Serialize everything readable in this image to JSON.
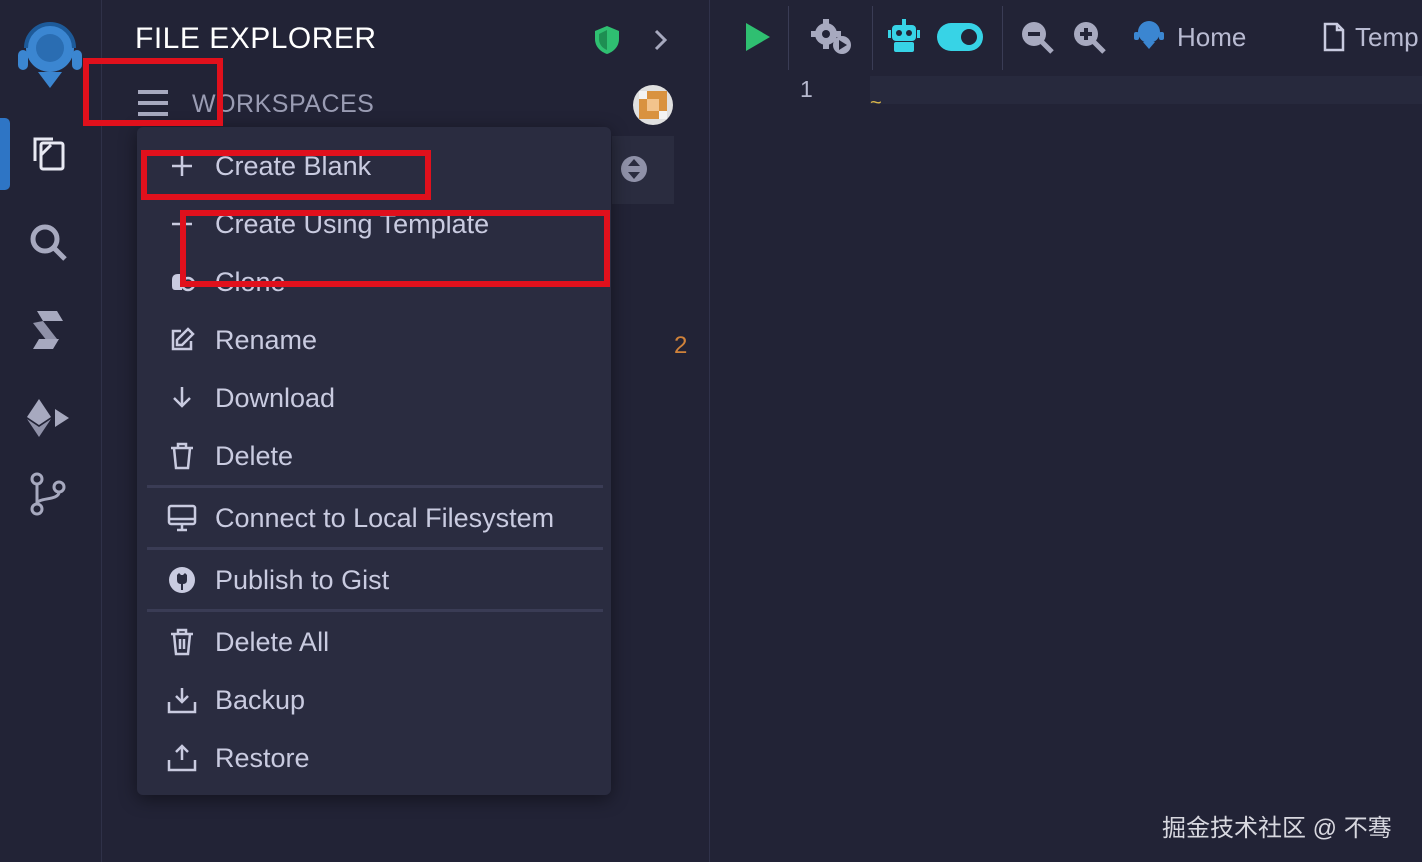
{
  "panel": {
    "title": "FILE EXPLORER",
    "workspaces_label": "WORKSPACES",
    "badge_count": "2"
  },
  "toolbar": {
    "home_label": "Home",
    "tab_label": "Temp"
  },
  "editor": {
    "line_number": "1"
  },
  "menu": {
    "items": [
      {
        "label": "Create Blank",
        "icon": "plus-icon"
      },
      {
        "label": "Create Using Template",
        "icon": "plus-icon"
      },
      {
        "label": "Clone",
        "icon": "clone-icon"
      },
      {
        "label": "Rename",
        "icon": "edit-icon"
      },
      {
        "label": "Download",
        "icon": "download-icon"
      },
      {
        "label": "Delete",
        "icon": "trash-icon"
      },
      {
        "label": "Connect to Local Filesystem",
        "icon": "monitor-icon"
      },
      {
        "label": "Publish to Gist",
        "icon": "github-icon"
      },
      {
        "label": "Delete All",
        "icon": "trash-all-icon"
      },
      {
        "label": "Backup",
        "icon": "backup-icon"
      },
      {
        "label": "Restore",
        "icon": "restore-icon"
      }
    ]
  },
  "colors": {
    "background": "#222336",
    "accent_blue": "#2e75c5",
    "annotation_red": "#e0101c",
    "run_green": "#2fbf71",
    "toggle_cyan": "#37d3e6"
  },
  "watermark": "掘金技术社区 @ 不骞"
}
